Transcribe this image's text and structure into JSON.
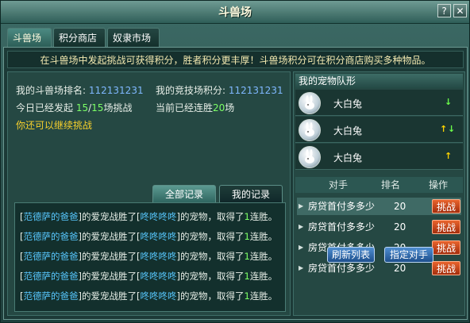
{
  "window": {
    "title": "斗兽场",
    "help_label": "?",
    "close_label": "✕"
  },
  "tabs": [
    {
      "label": "斗兽场",
      "active": true
    },
    {
      "label": "积分商店",
      "active": false
    },
    {
      "label": "奴隶市场",
      "active": false
    }
  ],
  "notice": "在斗兽场中发起挑战可获得积分，胜者积分更丰厚！斗兽场积分可在积分商店购买多种物品。",
  "stats": {
    "rank_label": "我的斗兽场排名:",
    "rank_value": "112131231",
    "points_label": "我的竞技场积分:",
    "points_value": "112131231",
    "challenges_prefix": "今日已经发起",
    "challenges_done": "15",
    "challenges_sep": "/",
    "challenges_max": "15",
    "challenges_suffix": "场挑战",
    "streak_prefix": "当前已经连胜",
    "streak_value": "20",
    "streak_suffix": "场",
    "can_continue": "你还可以继续挑战"
  },
  "record_tabs": {
    "all": "全部记录",
    "mine": "我的记录"
  },
  "records": [
    {
      "b1": "[",
      "name1": "范德萨的爸爸",
      "t1": "]的爱宠战胜了[",
      "name2": "咚咚咚咚",
      "t2": "]的宠物，取得了",
      "count": "1",
      "t3": "连胜。"
    },
    {
      "b1": "[",
      "name1": "范德萨的爸爸",
      "t1": "]的爱宠战胜了[",
      "name2": "咚咚咚咚",
      "t2": "]的宠物，取得了",
      "count": "1",
      "t3": "连胜。"
    },
    {
      "b1": "[",
      "name1": "范德萨的爸爸",
      "t1": "]的爱宠战胜了[",
      "name2": "咚咚咚咚",
      "t2": "]的宠物，取得了",
      "count": "1",
      "t3": "连胜。"
    },
    {
      "b1": "[",
      "name1": "范德萨的爸爸",
      "t1": "]的爱宠战胜了[",
      "name2": "咚咚咚咚",
      "t2": "]的宠物，取得了",
      "count": "1",
      "t3": "连胜。"
    },
    {
      "b1": "[",
      "name1": "范德萨的爸爸",
      "t1": "]的爱宠战胜了[",
      "name2": "咚咚咚咚",
      "t2": "]的宠物，取得了",
      "count": "1",
      "t3": "连胜。"
    }
  ],
  "team": {
    "header": "我的宠物队形",
    "pets": [
      {
        "name": "大白兔",
        "arrows": "down"
      },
      {
        "name": "大白兔",
        "arrows": "up-down"
      },
      {
        "name": "大白兔",
        "arrows": "up"
      }
    ]
  },
  "opponents": {
    "col_opponent": "对手",
    "col_rank": "排名",
    "col_action": "操作",
    "rows": [
      {
        "name": "房贷首付多多少",
        "rank": "20",
        "action": "挑战",
        "selected": true
      },
      {
        "name": "房贷首付多多少",
        "rank": "20",
        "action": "挑战",
        "selected": false
      },
      {
        "name": "房贷首付多多少",
        "rank": "20",
        "action": "挑战",
        "selected": false
      },
      {
        "name": "房贷首付多多少",
        "rank": "20",
        "action": "挑战",
        "selected": false
      }
    ]
  },
  "buttons": {
    "refresh": "刷新列表",
    "assign": "指定对手"
  },
  "icons": {
    "arrow_up": "↑",
    "arrow_down": "↓",
    "list_triangle": "▶"
  },
  "colors": {
    "accent": "#f7d02c",
    "fight_button": "#d24a1a",
    "name_blue": "#58c8ff",
    "count_green": "#7cff66"
  }
}
